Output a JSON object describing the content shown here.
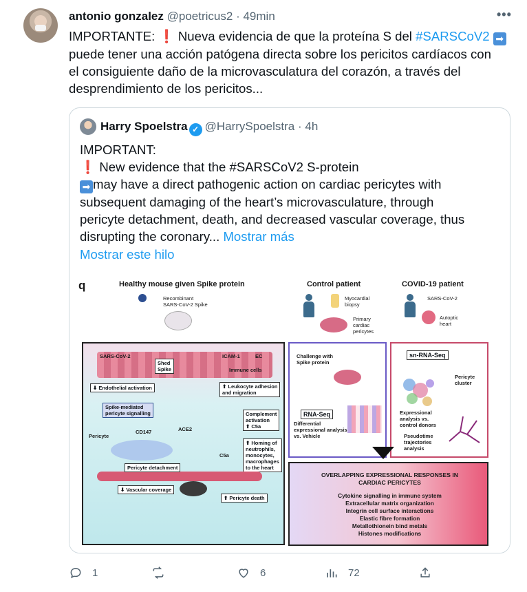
{
  "tweet": {
    "author_name": "antonio gonzalez",
    "author_handle": "@poetricus2",
    "separator": "·",
    "time": "49min",
    "more_label": "•••",
    "text_lines": {
      "l1_a": "IMPORTANTE: ",
      "l1_excl": "❗",
      "l1_b": " Nueva evidencia de que la proteína S del ",
      "l1_hashtag": "#SARSCoV2",
      "l1_arrow": "➡",
      "l2": "puede tener una acción patógena directa sobre los pericitos cardíacos con",
      "l3": "el consiguiente daño de la microvasculatura del corazón, a través del",
      "l4": "desprendimiento de los pericitos..."
    }
  },
  "quote": {
    "author_name": "Harry Spoelstra",
    "author_handle": "@HarrySpoelstra",
    "separator": "·",
    "time": "4h",
    "text_lines": {
      "l1": "IMPORTANT:",
      "l2_excl": "❗",
      "l2": "New evidence that the #SARSCoV2  S-protein",
      "l3_arrow": "➡",
      "l3": "may have a direct pathogenic action on cardiac pericytes with",
      "l4": "subsequent damaging of the heart’s microvasculature, through",
      "l5": "pericyte detachment, death, and decreased vascular coverage, thus",
      "l6": "disrupting the coronary...",
      "show_more": "Mostrar más"
    },
    "show_thread": "Mostrar este hilo"
  },
  "figure": {
    "panel_letter": "q",
    "title_a": "Healthy mouse given Spike protein",
    "title_b": "Control patient",
    "title_c": "COVID-19 patient",
    "recombinant": "Recombinant\nSARS-CoV-2 Spike",
    "myocardial": "Myocardial\nbiopsy",
    "primary": "Primary\ncardiac\npericytes",
    "sarscov2_c": "SARS-CoV-2",
    "autoptic": "Autoptic\nheart",
    "a_labels": {
      "sarscov2": "SARS-CoV-2",
      "shed_spike": "Shed\nSpike",
      "icam": "ICAM-1",
      "ec": "EC",
      "immune": "Immune cells",
      "endothelial": "⬇ Endothelial activation",
      "leukocyte": "⬆ Leukocyte adhesion\nand migration",
      "spike_signal": "Spike-mediated\npericyte signalling",
      "cd147": "CD147",
      "ace2": "ACE2",
      "complement": "Complement\nactivation\n⬆ C5a",
      "pericyte": "Pericyte",
      "c5a": "C5a",
      "homing": "⬆ Homing of\nneutrophils,\nmonocytes,\nmacrophages\nto the heart",
      "detachment": "Pericyte detachment",
      "vascular": "⬇ Vascular coverage",
      "death": "⬆ Pericyte death"
    },
    "b_labels": {
      "challenge": "Challenge with\nSpike protein",
      "rnaseq": "RNA-Seq",
      "diff": "Differential\nexpressional analysis\nvs. Vehicle"
    },
    "c_labels": {
      "snrnaseq": "sn-RNA-Seq",
      "cluster": "Pericyte\ncluster",
      "expr": "Expressional\nanalysis vs.\ncontrol donors",
      "pseudo": "Pseudotime\ntrajectories\nanalysis"
    },
    "d_title": "OVERLAPPING EXPRESSIONAL RESPONSES IN\nCARDIAC PERICYTES",
    "d_items": "Cytokine signalling in immune system\nExtracellular matrix organization\nIntegrin cell surface interactions\nElastic fibre formation\nMetallothionein bind metals\nHistones modifications"
  },
  "actions": {
    "reply_count": "1",
    "retweet_count": "",
    "like_count": "6",
    "views_count": "72"
  },
  "colors": {
    "link": "#1d9bf0",
    "secondary": "#536471",
    "border": "#cfd9de"
  }
}
